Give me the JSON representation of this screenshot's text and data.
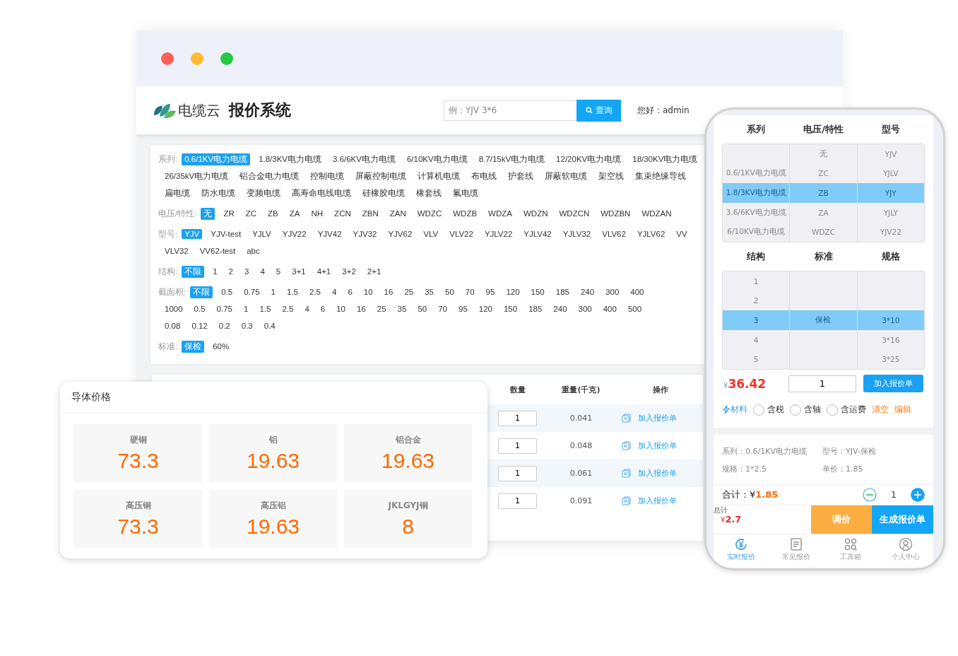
{
  "browser": {
    "logo_text": "电缆云",
    "title": "报价系统",
    "search": {
      "placeholder": "例：YJV 3*6",
      "button": "查询"
    },
    "greeting": "您好：admin",
    "filters": [
      {
        "label": "系列:",
        "lines": [
          [
            {
              "label": "0.6/1KV电力电缆",
              "selected": true
            },
            {
              "label": "1.8/3KV电力电缆",
              "selected": false
            },
            {
              "label": "3.6/6KV电力电缆",
              "selected": false
            },
            {
              "label": "6/10KV电力电缆",
              "selected": false
            },
            {
              "label": "8.7/15kV电力电缆",
              "selected": false
            },
            {
              "label": "12/20KV电力电缆",
              "selected": false
            },
            {
              "label": "18/30KV电力电缆",
              "selected": false
            }
          ],
          [
            {
              "label": "26/35kV电力电缆",
              "selected": false
            },
            {
              "label": "铝合金电力电缆",
              "selected": false
            },
            {
              "label": "控制电缆",
              "selected": false
            },
            {
              "label": "屏蔽控制电缆",
              "selected": false
            },
            {
              "label": "计算机电缆",
              "selected": false
            },
            {
              "label": "布电线",
              "selected": false
            },
            {
              "label": "护套线",
              "selected": false
            },
            {
              "label": "屏蔽软电缆",
              "selected": false
            },
            {
              "label": "架空线",
              "selected": false
            },
            {
              "label": "集束绝缘导线",
              "selected": false
            }
          ],
          [
            {
              "label": "扁电缆",
              "selected": false
            },
            {
              "label": "防水电缆",
              "selected": false
            },
            {
              "label": "变频电缆",
              "selected": false
            },
            {
              "label": "高寿命电线电缆",
              "selected": false
            },
            {
              "label": "硅橡胶电缆",
              "selected": false
            },
            {
              "label": "橡套线",
              "selected": false
            },
            {
              "label": "氟电缆",
              "selected": false
            }
          ]
        ]
      },
      {
        "label": "电压/特性:",
        "lines": [
          [
            {
              "label": "无",
              "selected": true
            },
            {
              "label": "ZR",
              "selected": false
            },
            {
              "label": "ZC",
              "selected": false
            },
            {
              "label": "ZB",
              "selected": false
            },
            {
              "label": "ZA",
              "selected": false
            },
            {
              "label": "NH",
              "selected": false
            },
            {
              "label": "ZCN",
              "selected": false
            },
            {
              "label": "ZBN",
              "selected": false
            },
            {
              "label": "ZAN",
              "selected": false
            },
            {
              "label": "WDZC",
              "selected": false
            },
            {
              "label": "WDZB",
              "selected": false
            },
            {
              "label": "WDZA",
              "selected": false
            },
            {
              "label": "WDZN",
              "selected": false
            },
            {
              "label": "WDZCN",
              "selected": false
            },
            {
              "label": "WDZBN",
              "selected": false
            },
            {
              "label": "WDZAN",
              "selected": false
            }
          ]
        ]
      },
      {
        "label": "型号:",
        "lines": [
          [
            {
              "label": "YJV",
              "selected": true
            },
            {
              "label": "YJV-test",
              "selected": false
            },
            {
              "label": "YJLV",
              "selected": false
            },
            {
              "label": "YJV22",
              "selected": false
            },
            {
              "label": "YJV42",
              "selected": false
            },
            {
              "label": "YJV32",
              "selected": false
            },
            {
              "label": "YJV62",
              "selected": false
            },
            {
              "label": "VLV",
              "selected": false
            },
            {
              "label": "VLV22",
              "selected": false
            },
            {
              "label": "YJLV22",
              "selected": false
            },
            {
              "label": "YJLV42",
              "selected": false
            },
            {
              "label": "YJLV32",
              "selected": false
            },
            {
              "label": "VLV62",
              "selected": false
            },
            {
              "label": "YJLV62",
              "selected": false
            },
            {
              "label": "VV",
              "selected": false
            }
          ],
          [
            {
              "label": "VLV32",
              "selected": false
            },
            {
              "label": "VV62-test",
              "selected": false
            },
            {
              "label": "abc",
              "selected": false
            }
          ]
        ]
      },
      {
        "label": "结构:",
        "lines": [
          [
            {
              "label": "不限",
              "selected": true
            },
            {
              "label": "1",
              "selected": false
            },
            {
              "label": "2",
              "selected": false
            },
            {
              "label": "3",
              "selected": false
            },
            {
              "label": "4",
              "selected": false
            },
            {
              "label": "5",
              "selected": false
            },
            {
              "label": "3+1",
              "selected": false
            },
            {
              "label": "4+1",
              "selected": false
            },
            {
              "label": "3+2",
              "selected": false
            },
            {
              "label": "2+1",
              "selected": false
            }
          ]
        ]
      },
      {
        "label": "截面积:",
        "lines": [
          [
            {
              "label": "不限",
              "selected": true
            },
            {
              "label": "0.5",
              "selected": false
            },
            {
              "label": "0.75",
              "selected": false
            },
            {
              "label": "1",
              "selected": false
            },
            {
              "label": "1.5",
              "selected": false
            },
            {
              "label": "2.5",
              "selected": false
            },
            {
              "label": "4",
              "selected": false
            },
            {
              "label": "6",
              "selected": false
            },
            {
              "label": "10",
              "selected": false
            },
            {
              "label": "16",
              "selected": false
            },
            {
              "label": "25",
              "selected": false
            },
            {
              "label": "35",
              "selected": false
            },
            {
              "label": "50",
              "selected": false
            },
            {
              "label": "70",
              "selected": false
            },
            {
              "label": "95",
              "selected": false
            },
            {
              "label": "120",
              "selected": false
            },
            {
              "label": "150",
              "selected": false
            },
            {
              "label": "185",
              "selected": false
            },
            {
              "label": "240",
              "selected": false
            },
            {
              "label": "300",
              "selected": false
            },
            {
              "label": "400",
              "selected": false
            }
          ],
          [
            {
              "label": "1000",
              "selected": false
            },
            {
              "label": "0.5",
              "selected": false
            },
            {
              "label": "0.75",
              "selected": false
            },
            {
              "label": "1",
              "selected": false
            },
            {
              "label": "1.5",
              "selected": false
            },
            {
              "label": "2.5",
              "selected": false
            },
            {
              "label": "4",
              "selected": false
            },
            {
              "label": "6",
              "selected": false
            },
            {
              "label": "10",
              "selected": false
            },
            {
              "label": "16",
              "selected": false
            },
            {
              "label": "25",
              "selected": false
            },
            {
              "label": "35",
              "selected": false
            },
            {
              "label": "50",
              "selected": false
            },
            {
              "label": "70",
              "selected": false
            },
            {
              "label": "95",
              "selected": false
            },
            {
              "label": "120",
              "selected": false
            },
            {
              "label": "150",
              "selected": false
            },
            {
              "label": "185",
              "selected": false
            },
            {
              "label": "240",
              "selected": false
            },
            {
              "label": "300",
              "selected": false
            },
            {
              "label": "400",
              "selected": false
            },
            {
              "label": "500",
              "selected": false
            }
          ],
          [
            {
              "label": "0.08",
              "selected": false
            },
            {
              "label": "0.12",
              "selected": false
            },
            {
              "label": "0.2",
              "selected": false
            },
            {
              "label": "0.3",
              "selected": false
            },
            {
              "label": "0.4",
              "selected": false
            }
          ]
        ]
      },
      {
        "label": "标准:",
        "lines": [
          [
            {
              "label": "保检",
              "selected": true
            },
            {
              "label": "60%",
              "selected": false
            }
          ]
        ]
      }
    ],
    "table": {
      "columns": [
        "数量",
        "重量(千克)",
        "操作"
      ],
      "rows": [
        {
          "quantity": "1",
          "weight": "0.041",
          "action": "加入报价单"
        },
        {
          "quantity": "1",
          "weight": "0.048",
          "action": "加入报价单"
        },
        {
          "quantity": "1",
          "weight": "0.061",
          "action": "加入报价单"
        },
        {
          "quantity": "1",
          "weight": "0.091",
          "action": "加入报价单"
        }
      ]
    }
  },
  "conductor_prices": {
    "title": "导体价格",
    "items": [
      {
        "name": "硬铜",
        "price": "73.3"
      },
      {
        "name": "铝",
        "price": "19.63"
      },
      {
        "name": "铝合金",
        "price": "19.63"
      },
      {
        "name": "高压铜",
        "price": "73.3"
      },
      {
        "name": "高压铝",
        "price": "19.63"
      },
      {
        "name": "JKLGYJ铜",
        "price": "8"
      }
    ]
  },
  "phone": {
    "pickers": [
      {
        "columns": [
          "系列",
          "电压/特性",
          "型号"
        ],
        "rows": [
          {
            "selected": false,
            "cells": [
              "",
              "无",
              "YJV"
            ]
          },
          {
            "selected": false,
            "cells": [
              "0.6/1KV电力电缆",
              "ZC",
              "YJLV"
            ]
          },
          {
            "selected": true,
            "cells": [
              "1.8/3KV电力电缆",
              "ZB",
              "YJY"
            ]
          },
          {
            "selected": false,
            "cells": [
              "3.6/6KV电力电缆",
              "ZA",
              "YJLY"
            ]
          },
          {
            "selected": false,
            "cells": [
              "6/10KV电力电缆",
              "WDZC",
              "YJV22"
            ]
          }
        ]
      },
      {
        "columns": [
          "结构",
          "标准",
          "规格"
        ],
        "rows": [
          {
            "selected": false,
            "cells": [
              "1",
              "",
              ""
            ]
          },
          {
            "selected": false,
            "cells": [
              "2",
              "",
              ""
            ]
          },
          {
            "selected": true,
            "cells": [
              "3",
              "保检",
              "3*10"
            ]
          },
          {
            "selected": false,
            "cells": [
              "4",
              "",
              "3*16"
            ]
          },
          {
            "selected": false,
            "cells": [
              "5",
              "",
              "3*25"
            ]
          }
        ]
      }
    ],
    "currency": "¥",
    "price": "36.42",
    "quantity": "1",
    "add_button": "加入报价单",
    "materials_link": "材料",
    "options": [
      {
        "label": "含税",
        "checked": false
      },
      {
        "label": "含轴",
        "checked": false
      },
      {
        "label": "含运费",
        "checked": false
      }
    ],
    "clear": "清空",
    "edit": "编辑",
    "info": [
      "系列：0.6/1KV电力电缆",
      "型号：YJV-保检",
      "规格：1*2.5",
      "单价：1.85"
    ],
    "total_label": "合计：",
    "total_currency": "¥",
    "total_amount": "1.85",
    "stepper_value": "1",
    "grand_label": "总计",
    "grand_currency": "¥",
    "grand_amount": "2.7",
    "adjust_button": "调价",
    "generate_button": "生成报价单",
    "tabs": [
      {
        "label": "实时报价",
        "kind": "yuan",
        "selected": true
      },
      {
        "label": "常见报价",
        "kind": "doc",
        "selected": false
      },
      {
        "label": "工具箱",
        "kind": "tools",
        "selected": false
      },
      {
        "label": "个人中心",
        "kind": "user",
        "selected": false
      }
    ]
  }
}
